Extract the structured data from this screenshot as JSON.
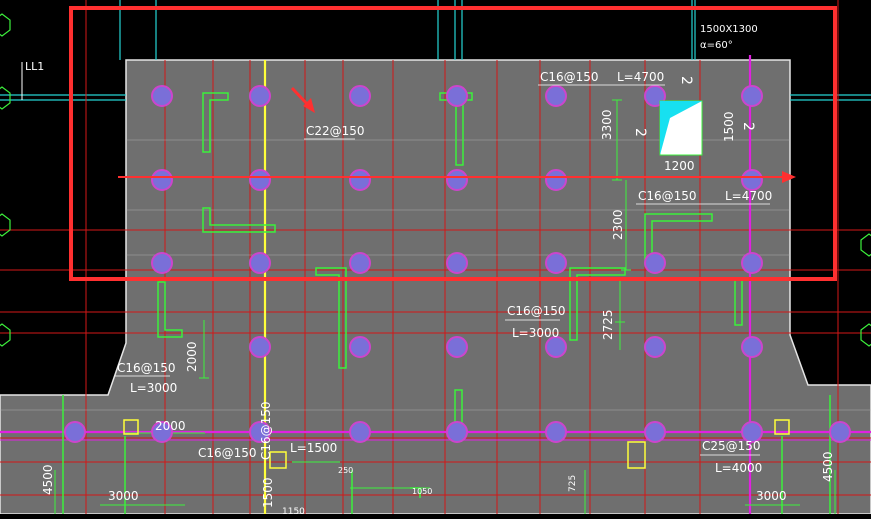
{
  "drawing": {
    "colors": {
      "background": "#000000",
      "slab_fill": "#707070",
      "slab_edge": "#e6e6e6",
      "gridline_red": "#d31717",
      "gridline_cyan": "#25d4d4",
      "gridline_magenta": "#e021e0",
      "centerline_yellow": "#ffff3a",
      "rebar_green": "#3cf03c",
      "label_white": "#ffffff",
      "pile_fill": "#7a6fd8",
      "pile_ring": "#cc45cc",
      "highlight_red": "#ff3030",
      "opening_cyan": "#17e0f0"
    },
    "labels": {
      "ll1": "LL1",
      "opening_size": "1500X1300",
      "opening_angle": "α=60°",
      "rebar_c22": "C22@150",
      "rebar_c16_top": "C16@150",
      "length_4700_top": "L=4700",
      "dim_3300": "3300",
      "dim_1500": "1500",
      "dim_1200": "1200",
      "rebar_c16_mid": "C16@150",
      "length_4700_mid": "L=4700",
      "dim_2300": "2300",
      "rebar_c16_center": "C16@150",
      "length_3000_center": "L=3000",
      "dim_2725": "2725",
      "rebar_c16_left": "C16@150",
      "length_3000_left": "L=3000",
      "dim_2000_vertical": "2000",
      "dim_2000_horizontal": "2000",
      "rebar_c16_bottom": "C16@150",
      "rebar_c16_vertical": "C16@150",
      "length_1500": "L=1500",
      "rebar_c25": "C25@150",
      "length_4000": "L=4000",
      "dim_4500_left": "4500",
      "dim_3000_left": "3000",
      "dim_4500_right": "4500",
      "dim_3000_right": "3000",
      "dim_1500_bottom": "1500",
      "dim_1150": "1150",
      "dim_250": "250",
      "dim_1050": "1050",
      "dim_725": "725",
      "mark_2_top": "2",
      "mark_2_right": "2",
      "mark_2_left": "2"
    }
  }
}
